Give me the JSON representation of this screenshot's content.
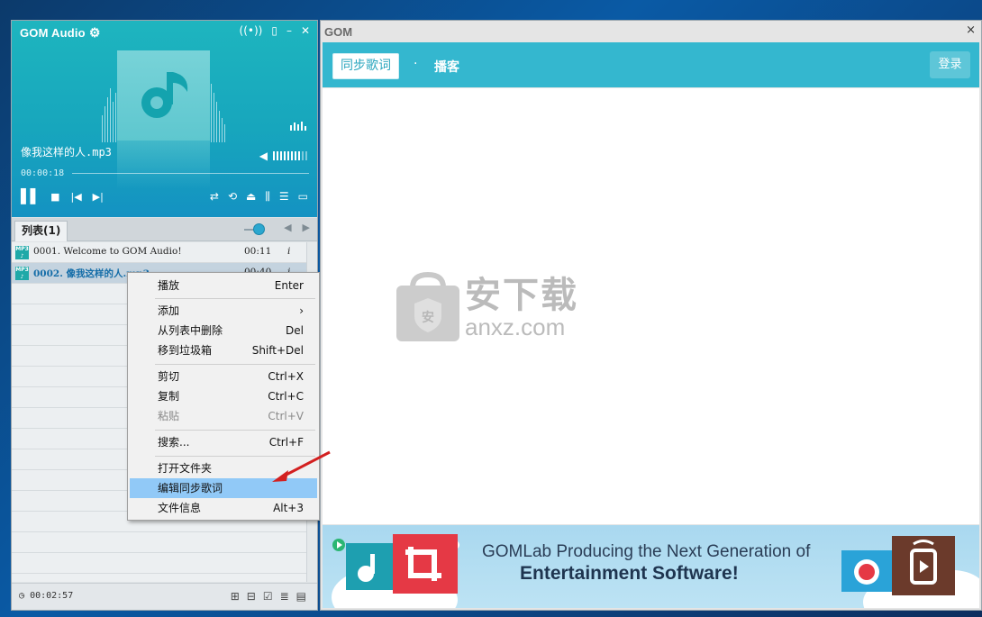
{
  "player": {
    "brand": "GOM Audio",
    "track_name": "像我这样的人.mp3",
    "current_time": "00:00:18",
    "volume_level": 0.8
  },
  "playlist": {
    "tab_label": "列表(1)",
    "items": [
      {
        "index_title": "0001. Welcome to GOM Audio!",
        "duration": "00:11",
        "info": "i"
      },
      {
        "index_title": "0002. 像我这样的人.mp3",
        "duration": "00:40",
        "info": "i"
      }
    ],
    "total_time": "00:02:57"
  },
  "context_menu": {
    "items": [
      {
        "label": "播放",
        "shortcut": "Enter"
      },
      {
        "label": "添加",
        "shortcut": "›"
      },
      {
        "label": "从列表中删除",
        "shortcut": "Del"
      },
      {
        "label": "移到垃圾箱",
        "shortcut": "Shift+Del"
      },
      {
        "label": "剪切",
        "shortcut": "Ctrl+X"
      },
      {
        "label": "复制",
        "shortcut": "Ctrl+C"
      },
      {
        "label": "粘贴",
        "shortcut": "Ctrl+V"
      },
      {
        "label": "搜索...",
        "shortcut": "Ctrl+F"
      },
      {
        "label": "打开文件夹",
        "shortcut": ""
      },
      {
        "label": "编辑同步歌词",
        "shortcut": ""
      },
      {
        "label": "文件信息",
        "shortcut": "Alt+3"
      }
    ]
  },
  "gom_window": {
    "title": "GOM",
    "close": "×",
    "tabs": {
      "lyrics": "同步歌词",
      "separator": "·",
      "podcast": "播客"
    },
    "login": "登录",
    "watermark": {
      "big": "安下载",
      "sub": "anxz.com"
    },
    "banner": {
      "line1": "GOMLab Producing the Next Generation of",
      "line2": "Entertainment Software!"
    }
  },
  "colors": {
    "player_teal": "#17a6bd",
    "nav_bar": "#34b7cf",
    "menu_highlight": "#91c9f7",
    "selected_row_text": "#146da8",
    "arrow_red": "#d32020"
  }
}
